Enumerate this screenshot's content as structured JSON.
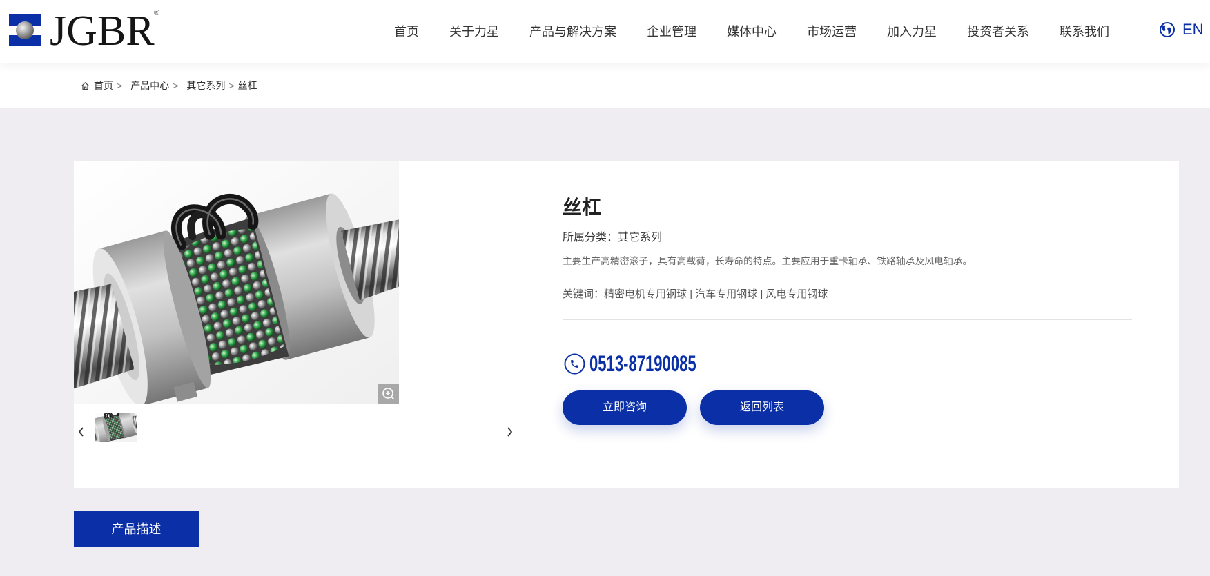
{
  "header": {
    "logo_text": "JGBR",
    "logo_reg": "®",
    "nav": [
      "首页",
      "关于力星",
      "产品与解决方案",
      "企业管理",
      "媒体中心",
      "市场运营",
      "加入力星",
      "投资者关系",
      "联系我们"
    ],
    "language": "EN"
  },
  "breadcrumb": {
    "separator": ">",
    "items": [
      "首页",
      "产品中心",
      "其它系列",
      "丝杠"
    ]
  },
  "product": {
    "title": "丝杠",
    "category_label": "所属分类：",
    "category": "其它系列",
    "description": "主要生产高精密滚子，具有高载荷，长寿命的特点。主要应用于重卡轴承、铁路轴承及风电轴承。",
    "keywords_label": "关键词：",
    "keyword_separator": " | ",
    "keywords": [
      "精密电机专用钢球",
      "汽车专用钢球",
      "风电专用钢球"
    ],
    "phone": "0513-87190085",
    "consult_button": "立即咨询",
    "back_button": "返回列表"
  },
  "tabs": [
    {
      "label": "产品描述"
    }
  ],
  "icons": {
    "logo": "logo-mark-icon",
    "language": "globe-icon",
    "breadcrumb_home": "home-icon",
    "zoom": "zoom-in-icon",
    "gallery_prev": "chevron-left-icon",
    "gallery_next": "chevron-right-icon",
    "phone": "phone-icon"
  },
  "colors": {
    "brand": "#0a2fa6",
    "page_background": "#efedf2"
  }
}
